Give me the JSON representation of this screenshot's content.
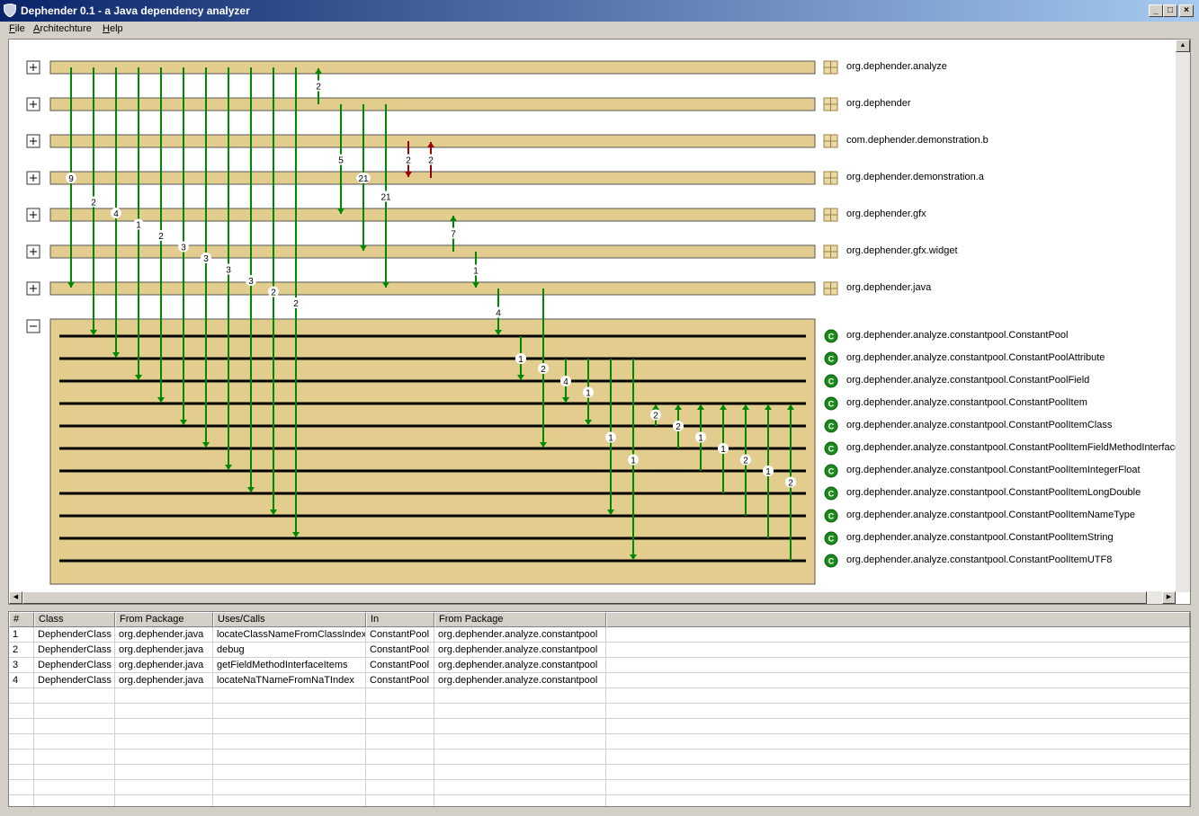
{
  "window": {
    "title": "Dephender 0.1 - a Java dependency analyzer"
  },
  "menu": [
    {
      "mnemonic": "F",
      "rest": "ile"
    },
    {
      "mnemonic": "A",
      "rest": "rchitechture"
    },
    {
      "mnemonic": "H",
      "rest": "elp"
    }
  ],
  "packages": [
    {
      "name": "org.dephender.analyze",
      "expanded": false
    },
    {
      "name": "org.dephender",
      "expanded": false
    },
    {
      "name": "com.dephender.demonstration.b",
      "expanded": false
    },
    {
      "name": "org.dephender.demonstration.a",
      "expanded": false
    },
    {
      "name": "org.dephender.gfx",
      "expanded": false
    },
    {
      "name": "org.dephender.gfx.widget",
      "expanded": false
    },
    {
      "name": "org.dephender.java",
      "expanded": false
    },
    {
      "name": "org.dephender.analyze.constantpool",
      "expanded": true
    }
  ],
  "classes": [
    "org.dephender.analyze.constantpool.ConstantPool",
    "org.dephender.analyze.constantpool.ConstantPoolAttribute",
    "org.dephender.analyze.constantpool.ConstantPoolField",
    "org.dephender.analyze.constantpool.ConstantPoolItem",
    "org.dephender.analyze.constantpool.ConstantPoolItemClass",
    "org.dephender.analyze.constantpool.ConstantPoolItemFieldMethodInterface",
    "org.dephender.analyze.constantpool.ConstantPoolItemIntegerFloat",
    "org.dephender.analyze.constantpool.ConstantPoolItemLongDouble",
    "org.dephender.analyze.constantpool.ConstantPoolItemNameType",
    "org.dephender.analyze.constantpool.ConstantPoolItemString",
    "org.dephender.analyze.constantpool.ConstantPoolItemUTF8"
  ],
  "dependencies": [
    {
      "col": 0,
      "from": "p0",
      "to": "p6",
      "count": "9",
      "dir": "down"
    },
    {
      "col": 1,
      "from": "p0",
      "to": "c0",
      "count": "2",
      "dir": "down"
    },
    {
      "col": 2,
      "from": "p0",
      "to": "c1",
      "count": "4",
      "dir": "down"
    },
    {
      "col": 3,
      "from": "p0",
      "to": "c2",
      "count": "1",
      "dir": "down"
    },
    {
      "col": 4,
      "from": "p0",
      "to": "c3",
      "count": "2",
      "dir": "down"
    },
    {
      "col": 5,
      "from": "p0",
      "to": "c4",
      "count": "3",
      "dir": "down"
    },
    {
      "col": 6,
      "from": "p0",
      "to": "c5",
      "count": "3",
      "dir": "down"
    },
    {
      "col": 7,
      "from": "p0",
      "to": "c6",
      "count": "3",
      "dir": "down"
    },
    {
      "col": 8,
      "from": "p0",
      "to": "c7",
      "count": "3",
      "dir": "down"
    },
    {
      "col": 9,
      "from": "p0",
      "to": "c8",
      "count": "2",
      "dir": "down"
    },
    {
      "col": 10,
      "from": "p0",
      "to": "c9",
      "count": "2",
      "dir": "down"
    },
    {
      "col": 11,
      "from": "p1",
      "to": "p0",
      "count": "2",
      "dir": "up"
    },
    {
      "col": 12,
      "from": "p1",
      "to": "p4",
      "count": "5",
      "dir": "down"
    },
    {
      "col": 13,
      "from": "p1",
      "to": "p5",
      "count": "21",
      "dir": "down"
    },
    {
      "col": 14,
      "from": "p1",
      "to": "p6",
      "count": "21",
      "dir": "down"
    },
    {
      "col": 15,
      "from": "p2",
      "to": "p3",
      "count": "2",
      "dir": "down",
      "cyclic": true
    },
    {
      "col": 16,
      "from": "p3",
      "to": "p2",
      "count": "2",
      "dir": "up",
      "cyclic": true
    },
    {
      "col": 17,
      "from": "p5",
      "to": "p4",
      "count": "7",
      "dir": "up"
    },
    {
      "col": 18,
      "from": "p5",
      "to": "p6",
      "count": "1",
      "dir": "down"
    },
    {
      "col": 19,
      "from": "p6",
      "to": "c0",
      "count": "4",
      "dir": "down"
    },
    {
      "col": 20,
      "from": "c0",
      "to": "c2",
      "count": "1",
      "dir": "down"
    },
    {
      "col": 21,
      "from": "p6",
      "to": "c5",
      "count": "2",
      "dir": "down"
    },
    {
      "col": 22,
      "from": "c1",
      "to": "c3",
      "count": "4",
      "dir": "down"
    },
    {
      "col": 23,
      "from": "c1",
      "to": "c4",
      "count": "1",
      "dir": "down"
    },
    {
      "col": 24,
      "from": "c1",
      "to": "c8",
      "count": "1",
      "dir": "down"
    },
    {
      "col": 25,
      "from": "c1",
      "to": "c10",
      "count": "1",
      "dir": "down"
    },
    {
      "col": 26,
      "from": "c4",
      "to": "c3",
      "count": "2",
      "dir": "up"
    },
    {
      "col": 27,
      "from": "c5",
      "to": "c3",
      "count": "2",
      "dir": "up"
    },
    {
      "col": 28,
      "from": "c6",
      "to": "c3",
      "count": "1",
      "dir": "up"
    },
    {
      "col": 29,
      "from": "c7",
      "to": "c3",
      "count": "1",
      "dir": "up"
    },
    {
      "col": 30,
      "from": "c8",
      "to": "c3",
      "count": "2",
      "dir": "up"
    },
    {
      "col": 31,
      "from": "c9",
      "to": "c3",
      "count": "1",
      "dir": "up"
    },
    {
      "col": 32,
      "from": "c10",
      "to": "c3",
      "count": "2",
      "dir": "up"
    }
  ],
  "table": {
    "columns": [
      "#",
      "Class",
      "From Package",
      "Uses/Calls",
      "In",
      "From Package"
    ],
    "rows": [
      [
        "1",
        "DephenderClass",
        "org.dephender.java",
        "locateClassNameFromClassIndex",
        "ConstantPool",
        "org.dephender.analyze.constantpool"
      ],
      [
        "2",
        "DephenderClass",
        "org.dephender.java",
        "debug",
        "ConstantPool",
        "org.dephender.analyze.constantpool"
      ],
      [
        "3",
        "DephenderClass",
        "org.dephender.java",
        "getFieldMethodInterfaceItems",
        "ConstantPool",
        "org.dephender.analyze.constantpool"
      ],
      [
        "4",
        "DephenderClass",
        "org.dephender.java",
        "locateNaTNameFromNaTIndex",
        "ConstantPool",
        "org.dephender.analyze.constantpool"
      ]
    ]
  },
  "colors": {
    "bar": "#e2cd8e",
    "arrow": "#008800",
    "cyclic": "#990000",
    "titlebar": "#0a246a"
  }
}
